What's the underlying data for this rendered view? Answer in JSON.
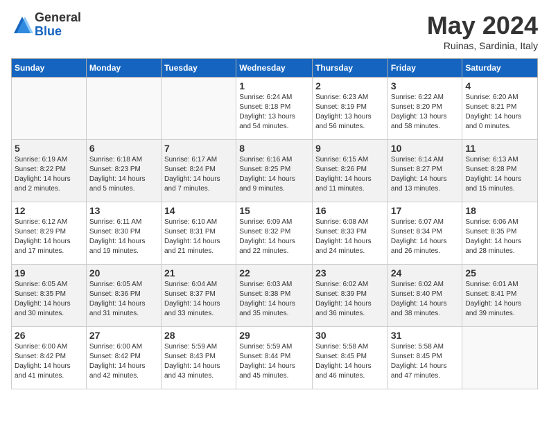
{
  "logo": {
    "general": "General",
    "blue": "Blue"
  },
  "title": "May 2024",
  "location": "Ruinas, Sardinia, Italy",
  "days_of_week": [
    "Sunday",
    "Monday",
    "Tuesday",
    "Wednesday",
    "Thursday",
    "Friday",
    "Saturday"
  ],
  "weeks": [
    [
      {
        "day": "",
        "info": ""
      },
      {
        "day": "",
        "info": ""
      },
      {
        "day": "",
        "info": ""
      },
      {
        "day": "1",
        "info": "Sunrise: 6:24 AM\nSunset: 8:18 PM\nDaylight: 13 hours\nand 54 minutes."
      },
      {
        "day": "2",
        "info": "Sunrise: 6:23 AM\nSunset: 8:19 PM\nDaylight: 13 hours\nand 56 minutes."
      },
      {
        "day": "3",
        "info": "Sunrise: 6:22 AM\nSunset: 8:20 PM\nDaylight: 13 hours\nand 58 minutes."
      },
      {
        "day": "4",
        "info": "Sunrise: 6:20 AM\nSunset: 8:21 PM\nDaylight: 14 hours\nand 0 minutes."
      }
    ],
    [
      {
        "day": "5",
        "info": "Sunrise: 6:19 AM\nSunset: 8:22 PM\nDaylight: 14 hours\nand 2 minutes."
      },
      {
        "day": "6",
        "info": "Sunrise: 6:18 AM\nSunset: 8:23 PM\nDaylight: 14 hours\nand 5 minutes."
      },
      {
        "day": "7",
        "info": "Sunrise: 6:17 AM\nSunset: 8:24 PM\nDaylight: 14 hours\nand 7 minutes."
      },
      {
        "day": "8",
        "info": "Sunrise: 6:16 AM\nSunset: 8:25 PM\nDaylight: 14 hours\nand 9 minutes."
      },
      {
        "day": "9",
        "info": "Sunrise: 6:15 AM\nSunset: 8:26 PM\nDaylight: 14 hours\nand 11 minutes."
      },
      {
        "day": "10",
        "info": "Sunrise: 6:14 AM\nSunset: 8:27 PM\nDaylight: 14 hours\nand 13 minutes."
      },
      {
        "day": "11",
        "info": "Sunrise: 6:13 AM\nSunset: 8:28 PM\nDaylight: 14 hours\nand 15 minutes."
      }
    ],
    [
      {
        "day": "12",
        "info": "Sunrise: 6:12 AM\nSunset: 8:29 PM\nDaylight: 14 hours\nand 17 minutes."
      },
      {
        "day": "13",
        "info": "Sunrise: 6:11 AM\nSunset: 8:30 PM\nDaylight: 14 hours\nand 19 minutes."
      },
      {
        "day": "14",
        "info": "Sunrise: 6:10 AM\nSunset: 8:31 PM\nDaylight: 14 hours\nand 21 minutes."
      },
      {
        "day": "15",
        "info": "Sunrise: 6:09 AM\nSunset: 8:32 PM\nDaylight: 14 hours\nand 22 minutes."
      },
      {
        "day": "16",
        "info": "Sunrise: 6:08 AM\nSunset: 8:33 PM\nDaylight: 14 hours\nand 24 minutes."
      },
      {
        "day": "17",
        "info": "Sunrise: 6:07 AM\nSunset: 8:34 PM\nDaylight: 14 hours\nand 26 minutes."
      },
      {
        "day": "18",
        "info": "Sunrise: 6:06 AM\nSunset: 8:35 PM\nDaylight: 14 hours\nand 28 minutes."
      }
    ],
    [
      {
        "day": "19",
        "info": "Sunrise: 6:05 AM\nSunset: 8:35 PM\nDaylight: 14 hours\nand 30 minutes."
      },
      {
        "day": "20",
        "info": "Sunrise: 6:05 AM\nSunset: 8:36 PM\nDaylight: 14 hours\nand 31 minutes."
      },
      {
        "day": "21",
        "info": "Sunrise: 6:04 AM\nSunset: 8:37 PM\nDaylight: 14 hours\nand 33 minutes."
      },
      {
        "day": "22",
        "info": "Sunrise: 6:03 AM\nSunset: 8:38 PM\nDaylight: 14 hours\nand 35 minutes."
      },
      {
        "day": "23",
        "info": "Sunrise: 6:02 AM\nSunset: 8:39 PM\nDaylight: 14 hours\nand 36 minutes."
      },
      {
        "day": "24",
        "info": "Sunrise: 6:02 AM\nSunset: 8:40 PM\nDaylight: 14 hours\nand 38 minutes."
      },
      {
        "day": "25",
        "info": "Sunrise: 6:01 AM\nSunset: 8:41 PM\nDaylight: 14 hours\nand 39 minutes."
      }
    ],
    [
      {
        "day": "26",
        "info": "Sunrise: 6:00 AM\nSunset: 8:42 PM\nDaylight: 14 hours\nand 41 minutes."
      },
      {
        "day": "27",
        "info": "Sunrise: 6:00 AM\nSunset: 8:42 PM\nDaylight: 14 hours\nand 42 minutes."
      },
      {
        "day": "28",
        "info": "Sunrise: 5:59 AM\nSunset: 8:43 PM\nDaylight: 14 hours\nand 43 minutes."
      },
      {
        "day": "29",
        "info": "Sunrise: 5:59 AM\nSunset: 8:44 PM\nDaylight: 14 hours\nand 45 minutes."
      },
      {
        "day": "30",
        "info": "Sunrise: 5:58 AM\nSunset: 8:45 PM\nDaylight: 14 hours\nand 46 minutes."
      },
      {
        "day": "31",
        "info": "Sunrise: 5:58 AM\nSunset: 8:45 PM\nDaylight: 14 hours\nand 47 minutes."
      },
      {
        "day": "",
        "info": ""
      }
    ]
  ]
}
